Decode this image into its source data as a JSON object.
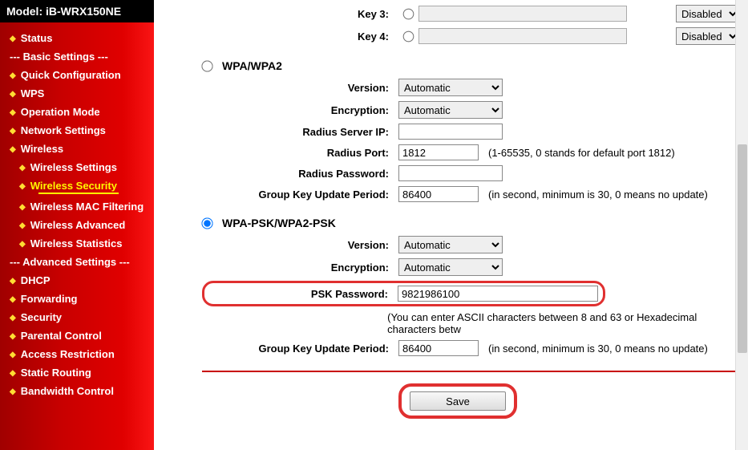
{
  "model": "Model: iB-WRX150NE",
  "nav": {
    "status": "Status",
    "basic_sep": "--- Basic Settings ---",
    "quick": "Quick Configuration",
    "wps": "WPS",
    "opmode": "Operation Mode",
    "network": "Network Settings",
    "wireless": "Wireless",
    "wsettings": "Wireless Settings",
    "wsecurity": "Wireless Security",
    "wmac": "Wireless MAC Filtering",
    "wadvanced": "Wireless Advanced",
    "wstats": "Wireless Statistics",
    "adv_sep": "--- Advanced Settings ---",
    "dhcp": "DHCP",
    "forwarding": "Forwarding",
    "security": "Security",
    "parental": "Parental Control",
    "access": "Access Restriction",
    "staticroute": "Static Routing",
    "bandwidth": "Bandwidth Control"
  },
  "topkeys": {
    "key3": "Key 3:",
    "key4": "Key 4:",
    "disabled": "Disabled"
  },
  "wpa": {
    "title": "WPA/WPA2",
    "version_label": "Version:",
    "encryption_label": "Encryption:",
    "radius_ip_label": "Radius Server IP:",
    "radius_port_label": "Radius Port:",
    "radius_pw_label": "Radius Password:",
    "group_key_label": "Group Key Update Period:",
    "automatic": "Automatic",
    "radius_port": "1812",
    "radius_port_note": "(1-65535, 0 stands for default port 1812)",
    "group_key": "86400",
    "group_key_note": "(in second, minimum is 30, 0 means no update)"
  },
  "psk": {
    "title": "WPA-PSK/WPA2-PSK",
    "version_label": "Version:",
    "encryption_label": "Encryption:",
    "psk_label": "PSK Password:",
    "psk_value": "9821986100",
    "psk_note": "(You can enter ASCII characters between 8 and 63 or Hexadecimal characters betw",
    "group_key_label": "Group Key Update Period:",
    "group_key": "86400",
    "group_key_note": "(in second, minimum is 30, 0 means no update)",
    "automatic": "Automatic"
  },
  "save_label": "Save"
}
